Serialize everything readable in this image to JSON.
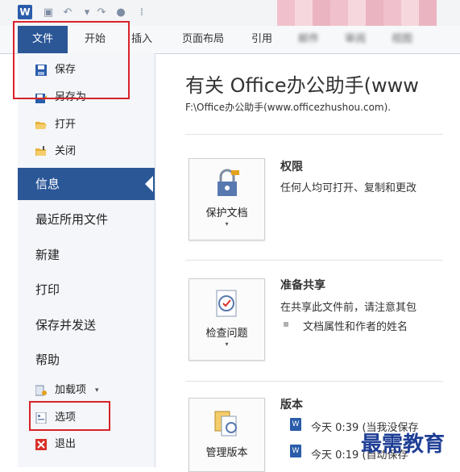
{
  "qat": {
    "logo": "W"
  },
  "ribbon": {
    "tabs": [
      "文件",
      "开始",
      "插入",
      "页面布局",
      "引用",
      "邮件",
      "审阅",
      "视图"
    ]
  },
  "backstage": {
    "commands": [
      {
        "label": "保存",
        "icon": "save-icon"
      },
      {
        "label": "另存为",
        "icon": "save-as-icon"
      },
      {
        "label": "打开",
        "icon": "open-folder-icon"
      },
      {
        "label": "关闭",
        "icon": "close-folder-icon"
      }
    ],
    "nav": [
      "信息",
      "最近所用文件",
      "新建",
      "打印",
      "保存并发送",
      "帮助"
    ],
    "bottom_commands": [
      {
        "label": "加载项",
        "icon": "addins-icon"
      },
      {
        "label": "选项",
        "icon": "options-icon"
      },
      {
        "label": "退出",
        "icon": "exit-icon"
      }
    ]
  },
  "info": {
    "title": "有关 Office办公助手(www",
    "path": "F:\\Office办公助手(www.officezhushou.com).",
    "sections": {
      "permissions": {
        "button": "保护文档",
        "heading": "权限",
        "text": "任何人均可打开、复制和更改"
      },
      "prepare": {
        "button": "检查问题",
        "heading": "准备共享",
        "text": "在共享此文件前，请注意其包",
        "bullet": "文档属性和作者的姓名"
      },
      "versions": {
        "button": "管理版本",
        "heading": "版本",
        "v1": "今天 0:39 (当我没保存",
        "v2": "今天 0:19 (自动保存"
      }
    }
  },
  "watermark": "最需教育",
  "colors": {
    "accent": "#2b5797",
    "highlight": "#d8232a"
  }
}
